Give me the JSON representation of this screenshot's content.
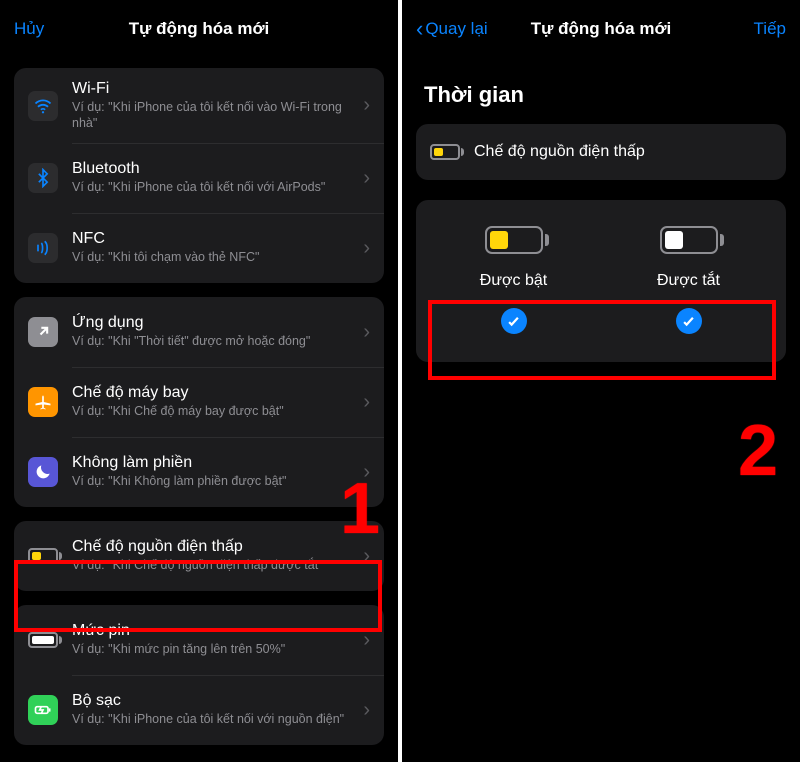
{
  "left": {
    "nav": {
      "cancel": "Hủy",
      "title": "Tự động hóa mới"
    },
    "group1": [
      {
        "key": "wifi",
        "title": "Wi-Fi",
        "sub": "Ví dụ: \"Khi iPhone của tôi kết nối vào Wi-Fi trong nhà\""
      },
      {
        "key": "bt",
        "title": "Bluetooth",
        "sub": "Ví dụ: \"Khi iPhone của tôi kết nối với AirPods\""
      },
      {
        "key": "nfc",
        "title": "NFC",
        "sub": "Ví dụ: \"Khi tôi chạm vào thẻ NFC\""
      }
    ],
    "group2": [
      {
        "key": "app",
        "title": "Ứng dụng",
        "sub": "Ví dụ: \"Khi \"Thời tiết\" được mở hoặc đóng\""
      },
      {
        "key": "air",
        "title": "Chế độ máy bay",
        "sub": "Ví dụ: \"Khi Chế độ máy bay được bật\""
      },
      {
        "key": "dnd",
        "title": "Không làm phiền",
        "sub": "Ví dụ: \"Khi Không làm phiền được bật\""
      }
    ],
    "group3": [
      {
        "key": "lpm",
        "title": "Chế độ nguồn điện thấp",
        "sub": "Ví dụ: \"Khi Chế độ nguồn điện thấp được tắt\""
      }
    ],
    "group4": [
      {
        "key": "level",
        "title": "Mức pin",
        "sub": "Ví dụ: \"Khi mức pin tăng lên trên 50%\""
      },
      {
        "key": "chg",
        "title": "Bộ sạc",
        "sub": "Ví dụ: \"Khi iPhone của tôi kết nối với nguồn điện\""
      }
    ],
    "annotation_number": "1"
  },
  "right": {
    "nav": {
      "back": "Quay lại",
      "title": "Tự động hóa mới",
      "next": "Tiếp"
    },
    "section": "Thời gian",
    "trigger_label": "Chế độ nguồn điện thấp",
    "option_on": "Được bật",
    "option_off": "Được tắt",
    "annotation_number": "2"
  }
}
